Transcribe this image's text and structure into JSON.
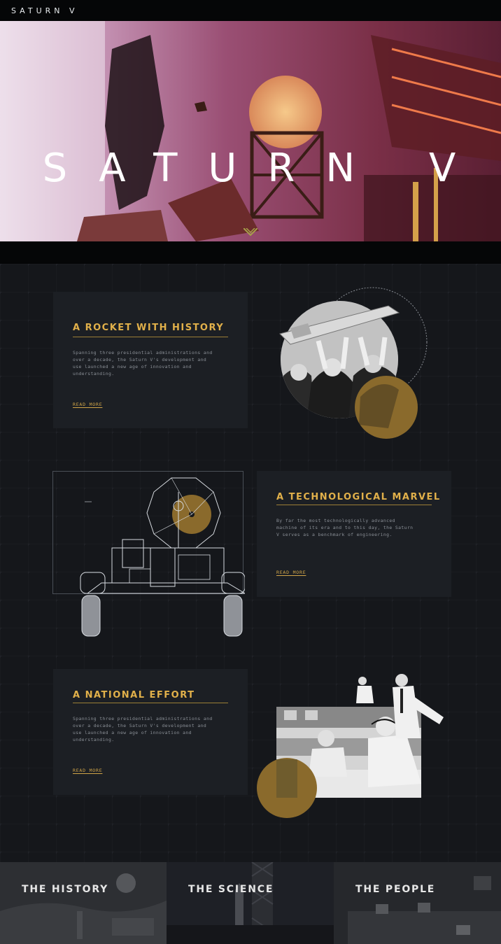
{
  "nav": {
    "brand": "SATURN V"
  },
  "hero": {
    "title": "SATURN V",
    "scroll_icon": "chevron-down-icon"
  },
  "sections": [
    {
      "title": "A ROCKET WITH HISTORY",
      "body": "Spanning three presidential administrations and over a decade, the Saturn V's development and use launched a new age of innovation and understanding.",
      "link": "READ MORE"
    },
    {
      "title": "A TECHNOLOGICAL MARVEL",
      "body": "By far the most technologically advanced machine of its era and to this day, the Saturn V serves as a benchmark of engineering.",
      "link": "READ MORE"
    },
    {
      "title": "A NATIONAL EFFORT",
      "body": "Spanning three presidential administrations and over a decade, the Saturn V's development and use launched a new age of innovation and understanding.",
      "link": "READ MORE"
    }
  ],
  "footer": {
    "tiles": [
      "THE HISTORY",
      "THE SCIENCE",
      "THE PEOPLE"
    ]
  },
  "colors": {
    "accent": "#e1b04a",
    "gold_circle": "#8a6a2c",
    "background": "#15171b",
    "card": "#1c1f24"
  }
}
